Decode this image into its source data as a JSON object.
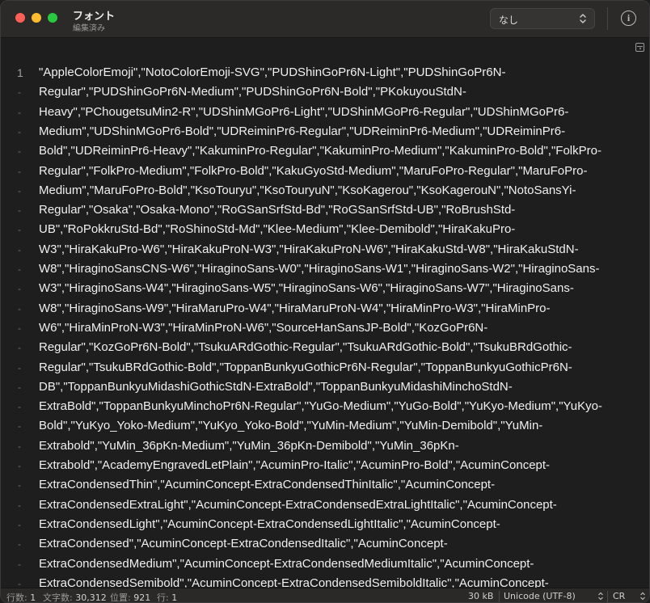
{
  "window": {
    "title": "フォント",
    "subtitle": "編集済み"
  },
  "toolbar": {
    "style_select_value": "なし",
    "info_label": "i"
  },
  "editor": {
    "line_number": "1",
    "continuation_marker": "-",
    "lines": [
      "\"AppleColorEmoji\",\"NotoColorEmoji-SVG\",\"PUDShinGoPr6N-Light\",\"PUDShinGoPr6N-",
      "Regular\",\"PUDShinGoPr6N-Medium\",\"PUDShinGoPr6N-Bold\",\"PKokuyouStdN-",
      "Heavy\",\"PChougetsuMin2-R\",\"UDShinMGoPr6-Light\",\"UDShinMGoPr6-Regular\",\"UDShinMGoPr6-",
      "Medium\",\"UDShinMGoPr6-Bold\",\"UDReiminPr6-Regular\",\"UDReiminPr6-Medium\",\"UDReiminPr6-",
      "Bold\",\"UDReiminPr6-Heavy\",\"KakuminPro-Regular\",\"KakuminPro-Medium\",\"KakuminPro-Bold\",\"FolkPro-",
      "Regular\",\"FolkPro-Medium\",\"FolkPro-Bold\",\"KakuGyoStd-Medium\",\"MaruFoPro-Regular\",\"MaruFoPro-",
      "Medium\",\"MaruFoPro-Bold\",\"KsoTouryu\",\"KsoTouryuN\",\"KsoKagerou\",\"KsoKagerouN\",\"NotoSansYi-",
      "Regular\",\"Osaka\",\"Osaka-Mono\",\"RoGSanSrfStd-Bd\",\"RoGSanSrfStd-UB\",\"RoBrushStd-",
      "UB\",\"RoPokkruStd-Bd\",\"RoShinoStd-Md\",\"Klee-Medium\",\"Klee-Demibold\",\"HiraKakuPro-",
      "W3\",\"HiraKakuPro-W6\",\"HiraKakuProN-W3\",\"HiraKakuProN-W6\",\"HiraKakuStd-W8\",\"HiraKakuStdN-",
      "W8\",\"HiraginoSansCNS-W6\",\"HiraginoSans-W0\",\"HiraginoSans-W1\",\"HiraginoSans-W2\",\"HiraginoSans-",
      "W3\",\"HiraginoSans-W4\",\"HiraginoSans-W5\",\"HiraginoSans-W6\",\"HiraginoSans-W7\",\"HiraginoSans-",
      "W8\",\"HiraginoSans-W9\",\"HiraMaruPro-W4\",\"HiraMaruProN-W4\",\"HiraMinPro-W3\",\"HiraMinPro-",
      "W6\",\"HiraMinProN-W3\",\"HiraMinProN-W6\",\"SourceHanSansJP-Bold\",\"KozGoPr6N-",
      "Regular\",\"KozGoPr6N-Bold\",\"TsukuARdGothic-Regular\",\"TsukuARdGothic-Bold\",\"TsukuBRdGothic-",
      "Regular\",\"TsukuBRdGothic-Bold\",\"ToppanBunkyuGothicPr6N-Regular\",\"ToppanBunkyuGothicPr6N-",
      "DB\",\"ToppanBunkyuMidashiGothicStdN-ExtraBold\",\"ToppanBunkyuMidashiMinchoStdN-",
      "ExtraBold\",\"ToppanBunkyuMinchoPr6N-Regular\",\"YuGo-Medium\",\"YuGo-Bold\",\"YuKyo-Medium\",\"YuKyo-",
      "Bold\",\"YuKyo_Yoko-Medium\",\"YuKyo_Yoko-Bold\",\"YuMin-Medium\",\"YuMin-Demibold\",\"YuMin-",
      "Extrabold\",\"YuMin_36pKn-Medium\",\"YuMin_36pKn-Demibold\",\"YuMin_36pKn-",
      "Extrabold\",\"AcademyEngravedLetPlain\",\"AcuminPro-Italic\",\"AcuminPro-Bold\",\"AcuminConcept-",
      "ExtraCondensedThin\",\"AcuminConcept-ExtraCondensedThinItalic\",\"AcuminConcept-",
      "ExtraCondensedExtraLight\",\"AcuminConcept-ExtraCondensedExtraLightItalic\",\"AcuminConcept-",
      "ExtraCondensedLight\",\"AcuminConcept-ExtraCondensedLightItalic\",\"AcuminConcept-",
      "ExtraCondensed\",\"AcuminConcept-ExtraCondensedItalic\",\"AcuminConcept-",
      "ExtraCondensedMedium\",\"AcuminConcept-ExtraCondensedMediumItalic\",\"AcuminConcept-",
      "ExtraCondensedSemibold\",\"AcuminConcept-ExtraCondensedSemiboldItalic\",\"AcuminConcept-"
    ]
  },
  "status": {
    "lines_label": "行数:",
    "lines_value": "1",
    "chars_label": "文字数:",
    "chars_value": "30,312",
    "position_label": "位置:",
    "position_value": "921",
    "row_label": "行:",
    "row_value": "1",
    "file_size": "30 kB",
    "encoding": "Unicode (UTF-8)",
    "line_ending": "CR"
  },
  "colors": {
    "background": "#1e1e1e",
    "titlebar": "#2b2a29",
    "text": "#f0f0f0",
    "close": "#fe5f57",
    "minimize": "#febc2e",
    "maximize": "#28c840"
  }
}
